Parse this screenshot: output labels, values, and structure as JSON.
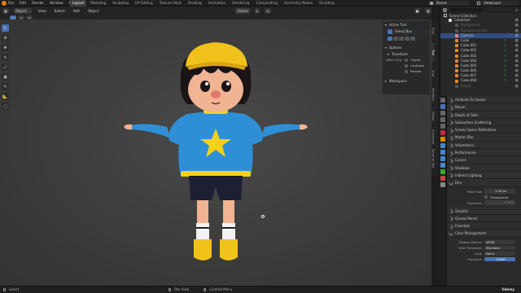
{
  "topbar": {
    "menu": [
      "File",
      "Edit",
      "Render",
      "Window",
      "Help"
    ],
    "workspaces": [
      "Layout",
      "Modeling",
      "Sculpting",
      "UV Editing",
      "Texture Paint",
      "Shading",
      "Animation",
      "Rendering",
      "Compositing",
      "Geometry Nodes",
      "Scripting"
    ],
    "active_workspace": "Layout",
    "scene": "Scene",
    "view_layer": "ViewLayer"
  },
  "viewport_header": {
    "mode": "Object Mode",
    "menus": [
      "View",
      "Select",
      "Add",
      "Object"
    ],
    "orientation": "Global"
  },
  "npanel": {
    "active_tool_title": "Active Tool",
    "active_tool_name": "Select Box",
    "options_title": "Options",
    "transform_title": "Transform",
    "affect_only_label": "Affect Only",
    "checkboxes": [
      "Origins",
      "Locations",
      "Parents"
    ],
    "workspace_title": "Workspace",
    "tabs": [
      "Item",
      "Tool",
      "View",
      "Modifiers",
      "Tissue",
      "Animation",
      "Dynamic Sky"
    ]
  },
  "outliner": {
    "title": "Scene Collection",
    "rows": [
      {
        "label": "Collection",
        "kind": "collection",
        "dim": false,
        "sel": false,
        "mark": false
      },
      {
        "label": "Background",
        "kind": "hidden",
        "dim": true,
        "sel": false,
        "mark": false
      },
      {
        "label": "Background.001",
        "kind": "hidden",
        "dim": true,
        "sel": false,
        "mark": false
      },
      {
        "label": "Camera",
        "kind": "camera",
        "dim": false,
        "sel": true,
        "mark": false
      },
      {
        "label": "Cube",
        "kind": "mesh",
        "dim": false,
        "sel": false,
        "mark": true
      },
      {
        "label": "Cube.001",
        "kind": "mesh",
        "dim": false,
        "sel": false,
        "mark": true
      },
      {
        "label": "Cube.002",
        "kind": "mesh",
        "dim": false,
        "sel": false,
        "mark": true
      },
      {
        "label": "Cube.003",
        "kind": "mesh",
        "dim": false,
        "sel": false,
        "mark": true
      },
      {
        "label": "Cube.004",
        "kind": "mesh",
        "dim": false,
        "sel": false,
        "mark": true
      },
      {
        "label": "Cube.005",
        "kind": "mesh",
        "dim": false,
        "sel": false,
        "mark": true
      },
      {
        "label": "Cube.006",
        "kind": "mesh",
        "dim": false,
        "sel": false,
        "mark": true
      },
      {
        "label": "Cube.007",
        "kind": "mesh",
        "dim": false,
        "sel": false,
        "mark": true
      },
      {
        "label": "Cube.008",
        "kind": "mesh",
        "dim": false,
        "sel": false,
        "mark": true
      },
      {
        "label": "Empty",
        "kind": "hidden",
        "dim": true,
        "sel": false,
        "mark": false
      }
    ]
  },
  "properties": {
    "sections": [
      {
        "label": "Ambient Occlusion",
        "open": false
      },
      {
        "label": "Bloom",
        "open": false
      },
      {
        "label": "Depth of Field",
        "open": false
      },
      {
        "label": "Subsurface Scattering",
        "open": false
      },
      {
        "label": "Screen Space Reflections",
        "open": false
      },
      {
        "label": "Motion Blur",
        "open": false
      },
      {
        "label": "Volumetrics",
        "open": false
      },
      {
        "label": "Performance",
        "open": false
      },
      {
        "label": "Curves",
        "open": false
      },
      {
        "label": "Shadows",
        "open": false
      },
      {
        "label": "Indirect Lighting",
        "open": false
      },
      {
        "label": "Film",
        "open": true
      }
    ],
    "film": {
      "filter_size_label": "Filter Size",
      "filter_size_value": "1.50 px",
      "transparent_label": "Transparent",
      "overscan_label": "Overscan",
      "overscan_value": "3.00%"
    },
    "sections2": [
      {
        "label": "Simplify",
        "open": false
      },
      {
        "label": "Grease Pencil",
        "open": false
      },
      {
        "label": "Freestyle",
        "open": false
      },
      {
        "label": "Color Management",
        "open": true
      }
    ],
    "color_management": [
      {
        "k": "Display Device",
        "v": "sRGB",
        "blue": false
      },
      {
        "k": "View Transform",
        "v": "Standard",
        "blue": false
      },
      {
        "k": "Look",
        "v": "None",
        "blue": false
      },
      {
        "k": "Exposure",
        "v": "0.000",
        "blue": true
      }
    ]
  },
  "statusbar": {
    "left": "Select",
    "middle_left": "Pan View",
    "middle": "Context Menu",
    "right": "Udemy"
  },
  "colors": {
    "accent": "#4772b3",
    "selected_row": "#334d80",
    "sweater": "#2f8fd6",
    "star": "#f4d21a",
    "hat": "#f2c21c"
  }
}
